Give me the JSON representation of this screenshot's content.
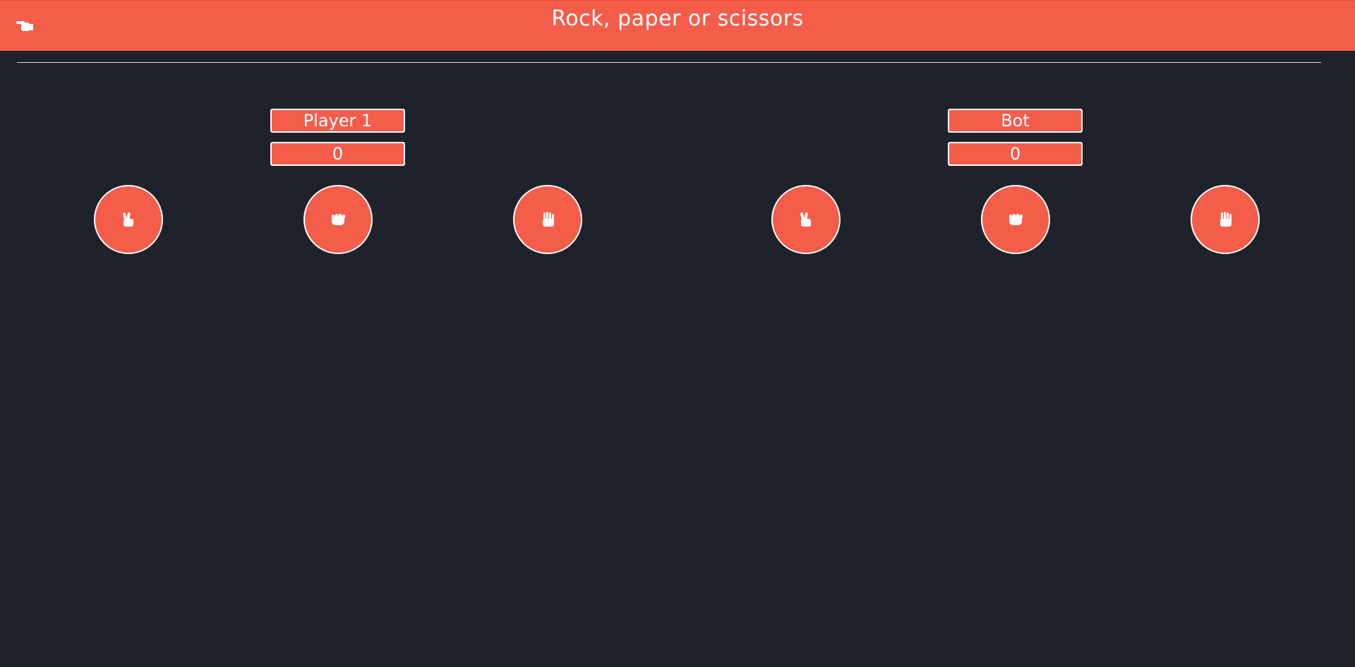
{
  "header": {
    "title": "Rock, paper or scissors",
    "back_icon": "pointing-hand-icon"
  },
  "players": [
    {
      "name": "Player 1",
      "score": "0",
      "choices": [
        {
          "icon": "scissors-hand-icon"
        },
        {
          "icon": "rock-hand-icon"
        },
        {
          "icon": "paper-hand-icon"
        }
      ]
    },
    {
      "name": "Bot",
      "score": "0",
      "choices": [
        {
          "icon": "scissors-hand-icon"
        },
        {
          "icon": "rock-hand-icon"
        },
        {
          "icon": "paper-hand-icon"
        }
      ]
    }
  ],
  "colors": {
    "accent": "#f55d4b",
    "background": "#1e222a",
    "text": "#ffffff"
  }
}
